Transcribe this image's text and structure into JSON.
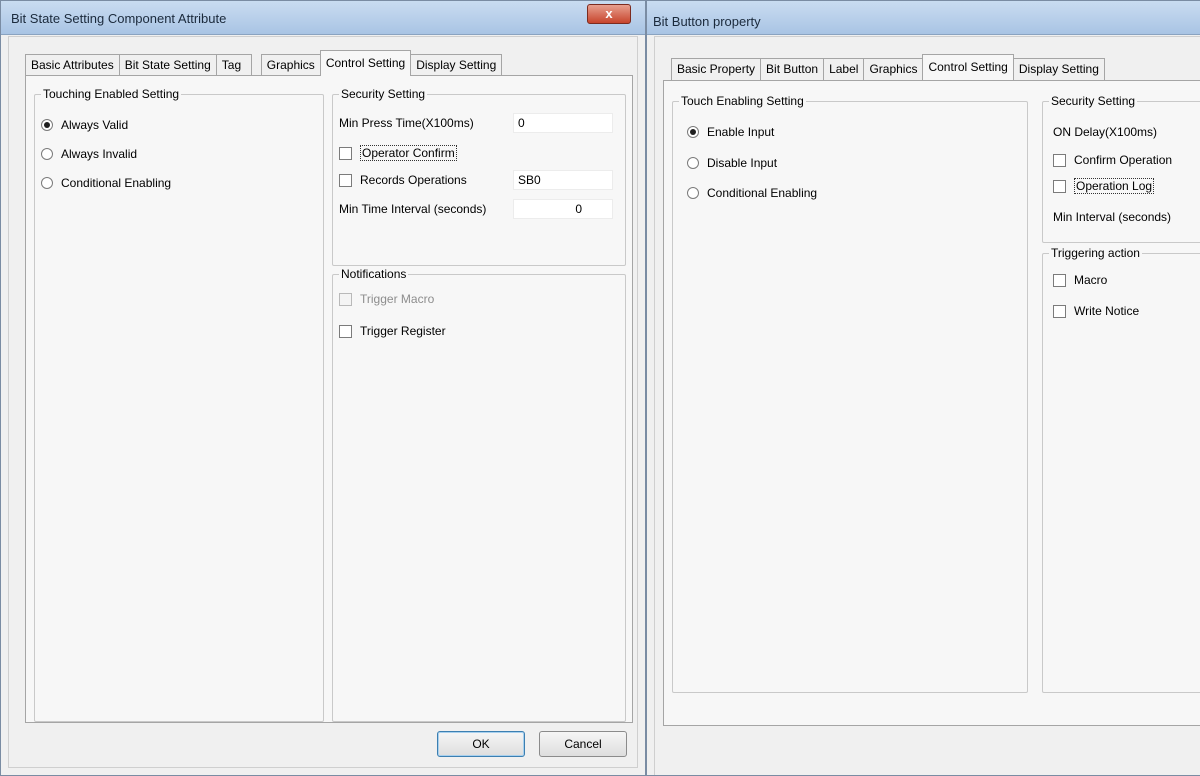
{
  "left_dialog": {
    "title": "Bit State Setting Component Attribute",
    "close_label": "x",
    "tabs": [
      {
        "label": "Basic Attributes"
      },
      {
        "label": "Bit State Setting"
      },
      {
        "label": "Tag"
      },
      {
        "label": "Graphics"
      },
      {
        "label": "Control Setting"
      },
      {
        "label": "Display Setting"
      }
    ],
    "active_tab": "Control Setting",
    "touch_group": {
      "title": "Touching Enabled Setting",
      "options": [
        {
          "label": "Always Valid",
          "selected": true
        },
        {
          "label": "Always Invalid",
          "selected": false
        },
        {
          "label": "Conditional Enabling",
          "selected": false
        }
      ]
    },
    "security_group": {
      "title": "Security Setting",
      "min_press_label": "Min Press Time(X100ms)",
      "min_press_value": "0",
      "operator_confirm_label": "Operator Confirm",
      "records_label": "Records Operations",
      "records_value": "SB0",
      "min_interval_label": "Min Time Interval (seconds)",
      "min_interval_value": "0"
    },
    "notifications_group": {
      "title": "Notifications",
      "trigger_macro_label": "Trigger Macro",
      "trigger_register_label": "Trigger Register"
    },
    "ok_label": "OK",
    "cancel_label": "Cancel"
  },
  "right_dialog": {
    "title": "Bit Button property",
    "tabs": [
      {
        "label": "Basic Property"
      },
      {
        "label": "Bit Button"
      },
      {
        "label": "Label"
      },
      {
        "label": "Graphics"
      },
      {
        "label": "Control Setting"
      },
      {
        "label": "Display Setting"
      }
    ],
    "active_tab": "Control Setting",
    "touch_group": {
      "title": "Touch Enabling Setting",
      "options": [
        {
          "label": "Enable Input",
          "selected": true
        },
        {
          "label": "Disable Input",
          "selected": false
        },
        {
          "label": "Conditional Enabling",
          "selected": false
        }
      ]
    },
    "security_group": {
      "title": "Security Setting",
      "on_delay_label": "ON Delay(X100ms)",
      "confirm_label": "Confirm Operation",
      "oplog_label": "Operation Log",
      "min_interval_label": "Min Interval (seconds)"
    },
    "trigger_group": {
      "title": "Triggering action",
      "macro_label": "Macro",
      "write_notice_label": "Write Notice"
    }
  }
}
